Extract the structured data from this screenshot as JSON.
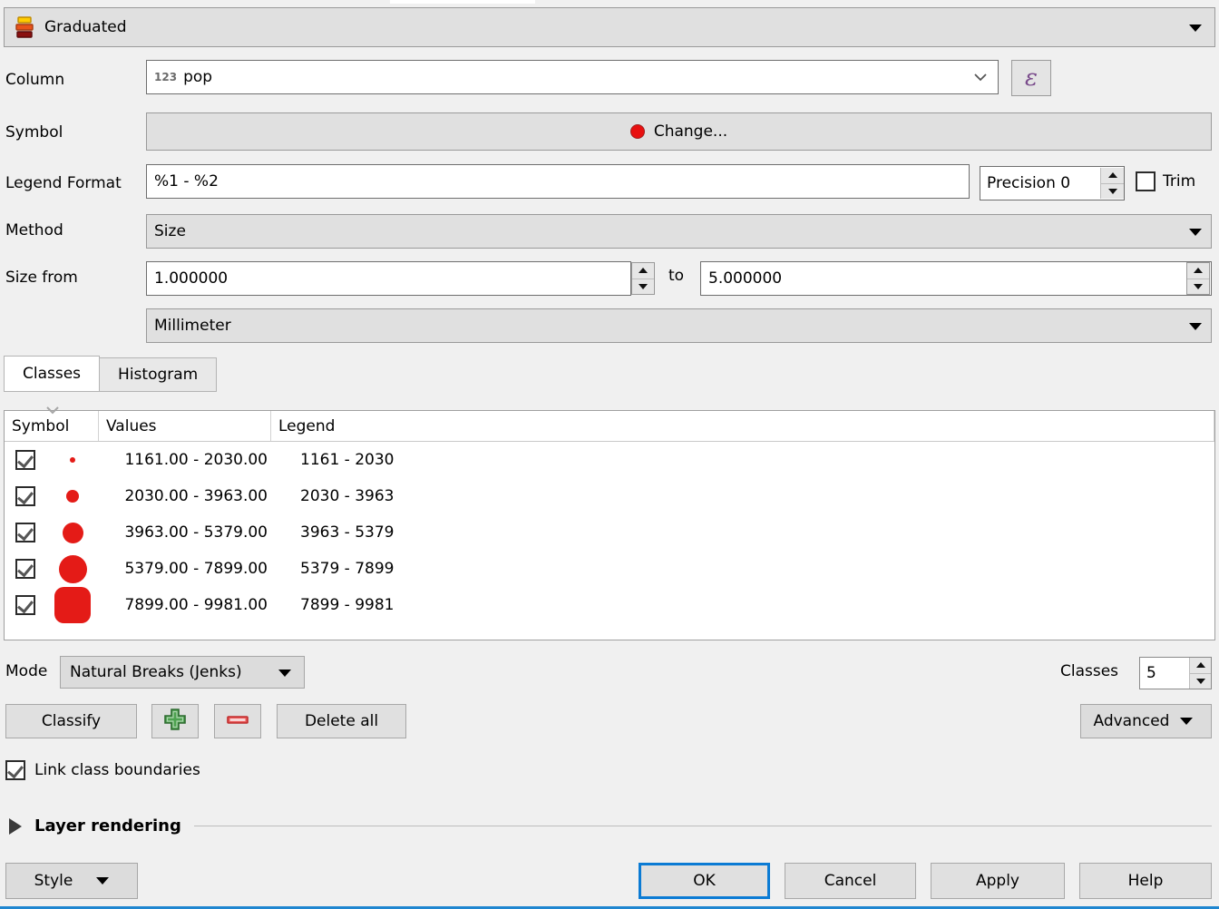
{
  "header": {
    "title": "Graduated",
    "icon": "graduated-icon",
    "caret_icon": "chevron-down-icon"
  },
  "form": {
    "column_label": "Column",
    "column_value": "pop",
    "column_type_badge": "123",
    "expression_button_glyph": "ε",
    "symbol_label": "Symbol",
    "symbol_change_label": "Change...",
    "symbol_color": "#e81010",
    "legend_format_label": "Legend Format",
    "legend_format_value": "%1 - %2",
    "precision_value": "Precision 0",
    "trim_label": "Trim",
    "trim_checked": false,
    "method_label": "Method",
    "method_value": "Size",
    "size_from_label": "Size from",
    "size_from_value": "1.000000",
    "to_label": "to",
    "size_to_value": "5.000000",
    "unit_value": "Millimeter"
  },
  "tabs": [
    {
      "label": "Classes",
      "active": true
    },
    {
      "label": "Histogram",
      "active": false
    }
  ],
  "table": {
    "columns": [
      "Symbol",
      "Values",
      "Legend"
    ],
    "sort_indicator_icon": "chevron-down-icon",
    "rows": [
      {
        "checked": true,
        "symbol_size": 6,
        "values": "1161.00 - 2030.00",
        "legend": "1161 - 2030"
      },
      {
        "checked": true,
        "symbol_size": 14,
        "values": "2030.00 - 3963.00",
        "legend": "2030 - 3963"
      },
      {
        "checked": true,
        "symbol_size": 23,
        "values": "3963.00 - 5379.00",
        "legend": "3963 - 5379"
      },
      {
        "checked": true,
        "symbol_size": 31,
        "values": "5379.00 - 7899.00",
        "legend": "5379 - 7899"
      },
      {
        "checked": true,
        "symbol_size": 40,
        "values": "7899.00 - 9981.00",
        "legend": "7899 - 9981"
      }
    ],
    "symbol_color": "#e41b17"
  },
  "mode": {
    "label": "Mode",
    "value": "Natural Breaks (Jenks)",
    "classes_label": "Classes",
    "classes_value": "5"
  },
  "actions": {
    "classify_label": "Classify",
    "add_icon": "plus-icon",
    "delete_icon": "minus-icon",
    "delete_all_label": "Delete all",
    "advanced_label": "Advanced",
    "add_icon_color": "#3f9141",
    "delete_icon_color": "#e04545"
  },
  "link_boundaries": {
    "label": "Link class boundaries",
    "checked": true
  },
  "layer_rendering": {
    "label": "Layer rendering",
    "expanded": false,
    "triangle_icon": "triangle-right-icon"
  },
  "footer": {
    "style_label": "Style",
    "ok_label": "OK",
    "cancel_label": "Cancel",
    "apply_label": "Apply",
    "help_label": "Help",
    "focus_color": "#0b7bd4",
    "accent_color": "#1f86d0"
  }
}
